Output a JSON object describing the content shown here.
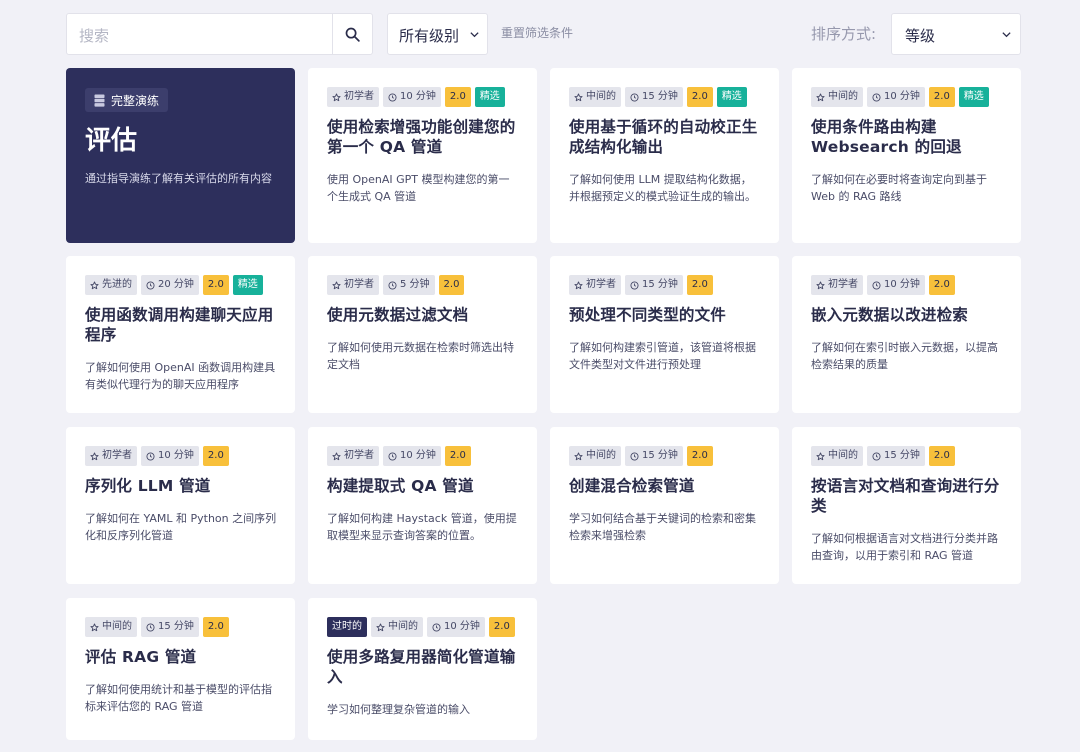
{
  "filters": {
    "search_placeholder": "搜索",
    "level_value": "所有级别",
    "reset_label": "重置筛选条件",
    "sort_label": "排序方式:",
    "sort_value": "等级"
  },
  "hero": {
    "tag": "完整演练",
    "title": "评估",
    "desc": "通过指导演练了解有关评估的所有内容"
  },
  "cards": [
    {
      "level": "初学者",
      "time": "10 分钟",
      "version": "2.0",
      "featured": "精选",
      "title": "使用检索增强功能创建您的第一个 QA 管道",
      "desc": "使用 OpenAI GPT 模型构建您的第一个生成式 QA 管道"
    },
    {
      "level": "中间的",
      "time": "15 分钟",
      "version": "2.0",
      "featured": "精选",
      "title": "使用基于循环的自动校正生成结构化输出",
      "desc": "了解如何使用 LLM 提取结构化数据，并根据预定义的模式验证生成的输出。"
    },
    {
      "level": "中间的",
      "time": "10 分钟",
      "version": "2.0",
      "featured": "精选",
      "title": "使用条件路由构建 Websearch 的回退",
      "desc": "了解如何在必要时将查询定向到基于 Web 的 RAG 路线"
    },
    {
      "level": "先进的",
      "time": "20 分钟",
      "version": "2.0",
      "featured": "精选",
      "title": "使用函数调用构建聊天应用程序",
      "desc": "了解如何使用 OpenAI 函数调用构建具有类似代理行为的聊天应用程序"
    },
    {
      "level": "初学者",
      "time": "5 分钟",
      "version": "2.0",
      "title": "使用元数据过滤文档",
      "desc": "了解如何使用元数据在检索时筛选出特定文档"
    },
    {
      "level": "初学者",
      "time": "15 分钟",
      "version": "2.0",
      "title": "预处理不同类型的文件",
      "desc": "了解如何构建索引管道，该管道将根据文件类型对文件进行预处理"
    },
    {
      "level": "初学者",
      "time": "10 分钟",
      "version": "2.0",
      "title": "嵌入元数据以改进检索",
      "desc": "了解如何在索引时嵌入元数据，以提高检索结果的质量"
    },
    {
      "level": "初学者",
      "time": "10 分钟",
      "version": "2.0",
      "title": "序列化 LLM 管道",
      "desc": "了解如何在 YAML 和 Python 之间序列化和反序列化管道"
    },
    {
      "level": "初学者",
      "time": "10 分钟",
      "version": "2.0",
      "title": "构建提取式 QA 管道",
      "desc": "了解如何构建 Haystack 管道，使用提取模型来显示查询答案的位置。"
    },
    {
      "level": "中间的",
      "time": "15 分钟",
      "version": "2.0",
      "title": "创建混合检索管道",
      "desc": "学习如何结合基于关键词的检索和密集检索来增强检索"
    },
    {
      "level": "中间的",
      "time": "15 分钟",
      "version": "2.0",
      "title": "按语言对文档和查询进行分类",
      "desc": "了解如何根据语言对文档进行分类并路由查询，以用于索引和 RAG 管道"
    },
    {
      "level": "中间的",
      "time": "15 分钟",
      "version": "2.0",
      "title": "评估 RAG 管道",
      "desc": "了解如何使用统计和基于模型的评估指标来评估您的 RAG 管道"
    },
    {
      "outdated": "过时的",
      "level": "中间的",
      "time": "10 分钟",
      "version": "2.0",
      "title": "使用多路复用器简化管道输入",
      "desc": "学习如何整理复杂管道的输入"
    }
  ],
  "colors": {
    "background": "#f1f1f7",
    "hero": "#2d2f5c",
    "version_badge": "#f8c03b",
    "featured_badge": "#17b19a"
  },
  "icons": {
    "search": "search-icon",
    "chevron": "chevron-down-icon",
    "star": "star-icon",
    "clock": "clock-icon",
    "walkthrough": "server-icon"
  }
}
